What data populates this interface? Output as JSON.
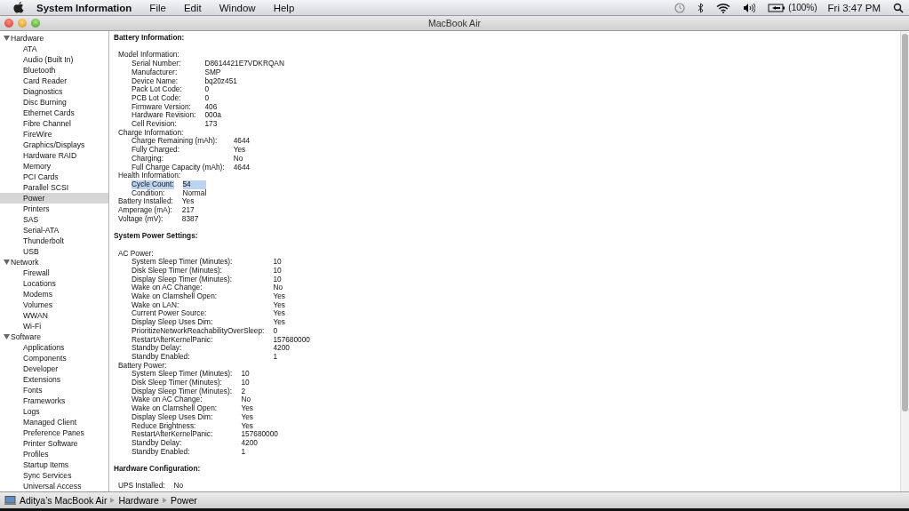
{
  "menubar": {
    "app_name": "System Information",
    "menus": [
      "File",
      "Edit",
      "Window",
      "Help"
    ],
    "battery_percent": "(100%)",
    "clock": "Fri 3:47 PM"
  },
  "window": {
    "title": "MacBook Air"
  },
  "sidebar": {
    "categories": [
      {
        "label": "Hardware",
        "expanded": true,
        "children": [
          {
            "label": "ATA",
            "selected": false
          },
          {
            "label": "Audio (Built In)",
            "selected": false
          },
          {
            "label": "Bluetooth",
            "selected": false
          },
          {
            "label": "Card Reader",
            "selected": false
          },
          {
            "label": "Diagnostics",
            "selected": false
          },
          {
            "label": "Disc Burning",
            "selected": false
          },
          {
            "label": "Ethernet Cards",
            "selected": false
          },
          {
            "label": "Fibre Channel",
            "selected": false
          },
          {
            "label": "FireWire",
            "selected": false
          },
          {
            "label": "Graphics/Displays",
            "selected": false
          },
          {
            "label": "Hardware RAID",
            "selected": false
          },
          {
            "label": "Memory",
            "selected": false
          },
          {
            "label": "PCI Cards",
            "selected": false
          },
          {
            "label": "Parallel SCSI",
            "selected": false
          },
          {
            "label": "Power",
            "selected": true
          },
          {
            "label": "Printers",
            "selected": false
          },
          {
            "label": "SAS",
            "selected": false
          },
          {
            "label": "Serial-ATA",
            "selected": false
          },
          {
            "label": "Thunderbolt",
            "selected": false
          },
          {
            "label": "USB",
            "selected": false
          }
        ]
      },
      {
        "label": "Network",
        "expanded": true,
        "children": [
          {
            "label": "Firewall",
            "selected": false
          },
          {
            "label": "Locations",
            "selected": false
          },
          {
            "label": "Modems",
            "selected": false
          },
          {
            "label": "Volumes",
            "selected": false
          },
          {
            "label": "WWAN",
            "selected": false
          },
          {
            "label": "Wi-Fi",
            "selected": false
          }
        ]
      },
      {
        "label": "Software",
        "expanded": true,
        "children": [
          {
            "label": "Applications",
            "selected": false
          },
          {
            "label": "Components",
            "selected": false
          },
          {
            "label": "Developer",
            "selected": false
          },
          {
            "label": "Extensions",
            "selected": false
          },
          {
            "label": "Fonts",
            "selected": false
          },
          {
            "label": "Frameworks",
            "selected": false
          },
          {
            "label": "Logs",
            "selected": false
          },
          {
            "label": "Managed Client",
            "selected": false
          },
          {
            "label": "Preference Panes",
            "selected": false
          },
          {
            "label": "Printer Software",
            "selected": false
          },
          {
            "label": "Profiles",
            "selected": false
          },
          {
            "label": "Startup Items",
            "selected": false
          },
          {
            "label": "Sync Services",
            "selected": false
          },
          {
            "label": "Universal Access",
            "selected": false
          }
        ]
      }
    ]
  },
  "content": {
    "sections": [
      {
        "title": "Battery Information:",
        "blocks": [
          {
            "kind": "group",
            "label": "Model Information:",
            "rows": [
              {
                "label": "Serial Number:",
                "value": "D8614421E7VDKRQAN",
                "selected": false
              },
              {
                "label": "Manufacturer:",
                "value": "SMP",
                "selected": false
              },
              {
                "label": "Device Name:",
                "value": "bq20z451",
                "selected": false
              },
              {
                "label": "Pack Lot Code:",
                "value": "0",
                "selected": false
              },
              {
                "label": "PCB Lot Code:",
                "value": "0",
                "selected": false
              },
              {
                "label": "Firmware Version:",
                "value": "406",
                "selected": false
              },
              {
                "label": "Hardware Revision:",
                "value": "000a",
                "selected": false
              },
              {
                "label": "Cell Revision:",
                "value": "173",
                "selected": false
              }
            ]
          },
          {
            "kind": "group",
            "label": "Charge Information:",
            "rows": [
              {
                "label": "Charge Remaining (mAh):",
                "value": "4644",
                "selected": false
              },
              {
                "label": "Fully Charged:",
                "value": "Yes",
                "selected": false
              },
              {
                "label": "Charging:",
                "value": "No",
                "selected": false
              },
              {
                "label": "Full Charge Capacity (mAh):",
                "value": "4644",
                "selected": false
              }
            ]
          },
          {
            "kind": "group",
            "label": "Health Information:",
            "rows": [
              {
                "label": "Cycle Count:",
                "value": "54",
                "selected": true
              },
              {
                "label": "Condition:",
                "value": "Normal",
                "selected": false
              }
            ]
          },
          {
            "kind": "fields",
            "rows": [
              {
                "label": "Battery Installed:",
                "value": "Yes",
                "selected": false
              },
              {
                "label": "Amperage (mA):",
                "value": "217",
                "selected": false
              },
              {
                "label": "Voltage (mV):",
                "value": "8387",
                "selected": false
              }
            ]
          }
        ]
      },
      {
        "title": "System Power Settings:",
        "blocks": [
          {
            "kind": "group",
            "label": "AC Power:",
            "rows": [
              {
                "label": "System Sleep Timer (Minutes):",
                "value": "10",
                "selected": false
              },
              {
                "label": "Disk Sleep Timer (Minutes):",
                "value": "10",
                "selected": false
              },
              {
                "label": "Display Sleep Timer (Minutes):",
                "value": "10",
                "selected": false
              },
              {
                "label": "Wake on AC Change:",
                "value": "No",
                "selected": false
              },
              {
                "label": "Wake on Clamshell Open:",
                "value": "Yes",
                "selected": false
              },
              {
                "label": "Wake on LAN:",
                "value": "Yes",
                "selected": false
              },
              {
                "label": "Current Power Source:",
                "value": "Yes",
                "selected": false
              },
              {
                "label": "Display Sleep Uses Dim:",
                "value": "Yes",
                "selected": false
              },
              {
                "label": "PrioritizeNetworkReachabilityOverSleep:",
                "value": "0",
                "selected": false
              },
              {
                "label": "RestartAfterKernelPanic:",
                "value": "157680000",
                "selected": false
              },
              {
                "label": "Standby Delay:",
                "value": "4200",
                "selected": false
              },
              {
                "label": "Standby Enabled:",
                "value": "1",
                "selected": false
              }
            ]
          },
          {
            "kind": "group",
            "label": "Battery Power:",
            "rows": [
              {
                "label": "System Sleep Timer (Minutes):",
                "value": "10",
                "selected": false
              },
              {
                "label": "Disk Sleep Timer (Minutes):",
                "value": "10",
                "selected": false
              },
              {
                "label": "Display Sleep Timer (Minutes):",
                "value": "2",
                "selected": false
              },
              {
                "label": "Wake on AC Change:",
                "value": "No",
                "selected": false
              },
              {
                "label": "Wake on Clamshell Open:",
                "value": "Yes",
                "selected": false
              },
              {
                "label": "Display Sleep Uses Dim:",
                "value": "Yes",
                "selected": false
              },
              {
                "label": "Reduce Brightness:",
                "value": "Yes",
                "selected": false
              },
              {
                "label": "RestartAfterKernelPanic:",
                "value": "157680000",
                "selected": false
              },
              {
                "label": "Standby Delay:",
                "value": "4200",
                "selected": false
              },
              {
                "label": "Standby Enabled:",
                "value": "1",
                "selected": false
              }
            ]
          }
        ]
      },
      {
        "title": "Hardware Configuration:",
        "blocks": [
          {
            "kind": "fields",
            "rows": [
              {
                "label": "UPS Installed:",
                "value": "No",
                "selected": false
              }
            ]
          }
        ]
      }
    ]
  },
  "path_bar": [
    "Aditya’s MacBook Air",
    "Hardware",
    "Power"
  ]
}
